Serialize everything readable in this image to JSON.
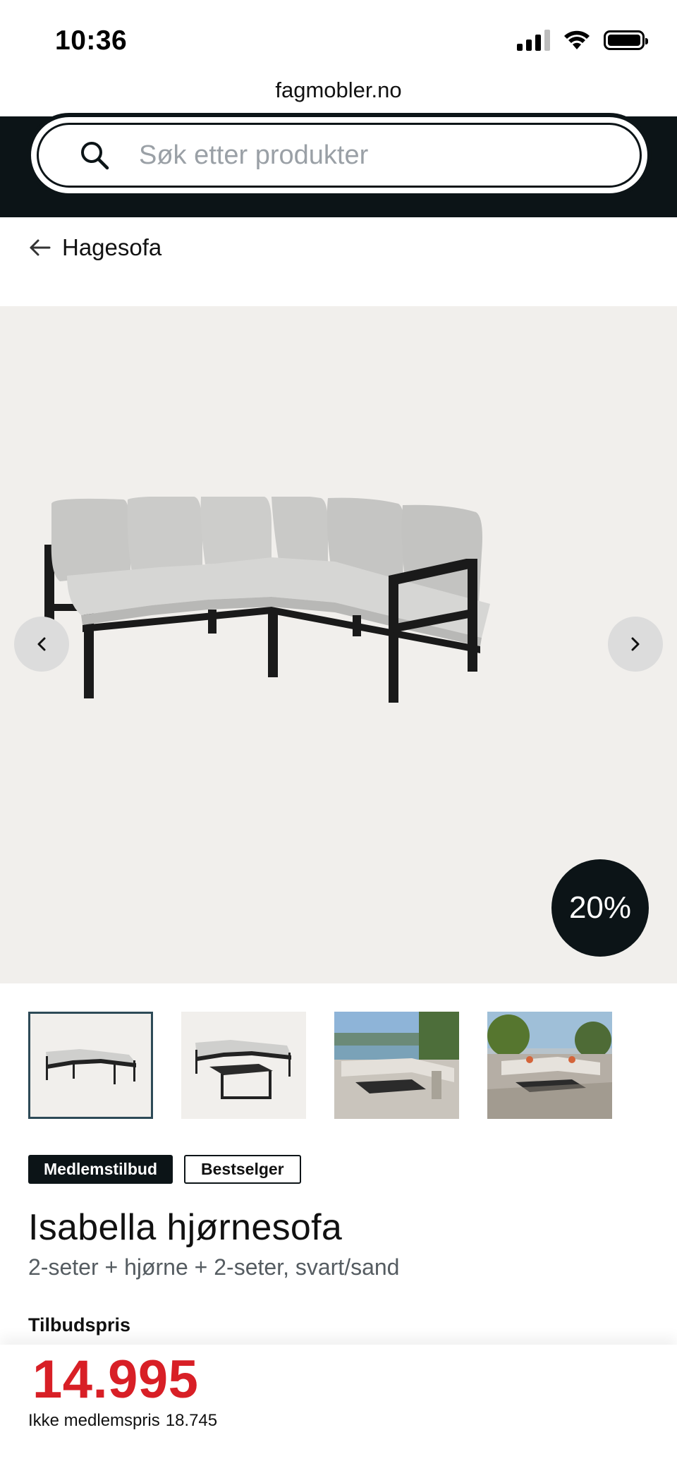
{
  "status_bar": {
    "time": "10:36"
  },
  "browser": {
    "url": "fagmobler.no"
  },
  "search": {
    "placeholder": "Søk etter produkter"
  },
  "breadcrumb": {
    "label": "Hagesofa"
  },
  "gallery": {
    "discount": "20%"
  },
  "badges": {
    "member_offer": "Medlemstilbud",
    "bestseller": "Bestselger"
  },
  "product": {
    "title": "Isabella hjørnesofa",
    "subtitle": "2-seter + hjørne + 2-seter, svart/sand"
  },
  "pricing": {
    "label": "Tilbudspris",
    "price": "14.995",
    "non_member_label": "Ikke medlemspris",
    "non_member_price": "18.745"
  },
  "colors": {
    "dark": "#0c1417",
    "price_red": "#d81f26",
    "gallery_bg": "#f1efec"
  }
}
